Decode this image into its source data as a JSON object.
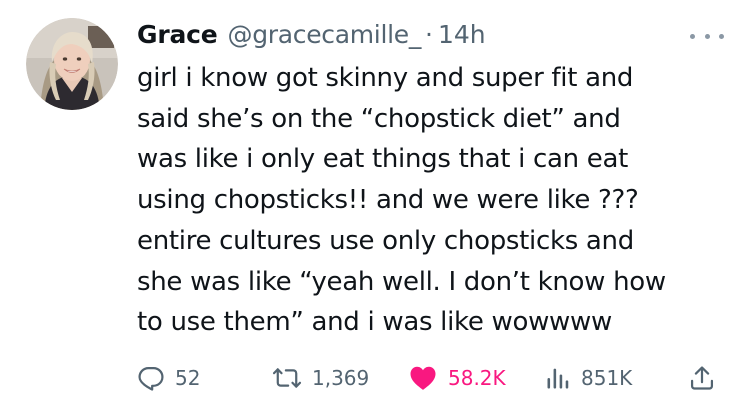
{
  "author": {
    "display_name": "Grace",
    "handle": "@gracecamille_",
    "separator": "·",
    "time": "14h"
  },
  "tweet": {
    "lines": [
      "girl i know got skinny and super fit and",
      "said she’s on the “chopstick diet” and",
      "was like i only eat things that i can eat",
      "using chopsticks!! and we were like ???",
      "entire cultures use only chopsticks and",
      "she was like “yeah well. I don’t know how",
      "to use them” and i was like wowwww"
    ]
  },
  "actions": {
    "replies": "52",
    "retweets": "1,369",
    "likes": "58.2K",
    "views": "851K"
  },
  "icons": {
    "reply": "reply-icon",
    "retweet": "retweet-icon",
    "like": "heart-icon",
    "views": "views-icon",
    "share": "share-icon",
    "more": "more-icon"
  },
  "colors": {
    "text": "#0f1419",
    "secondary": "#536471",
    "like": "#f91880"
  }
}
